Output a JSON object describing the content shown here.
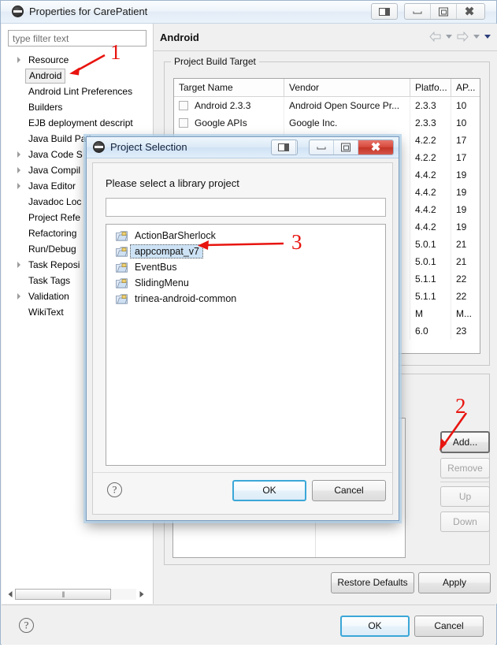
{
  "window": {
    "title": "Properties for CarePatient",
    "icon": "eclipse-icon",
    "titlebar_buttons": [
      {
        "name": "restore-pane-icon",
        "label": ""
      },
      {
        "name": "minimize-icon",
        "label": ""
      },
      {
        "name": "maximize-icon",
        "label": ""
      },
      {
        "name": "close-icon",
        "label": "✕"
      }
    ]
  },
  "sidebar": {
    "filter": {
      "placeholder": "type filter text",
      "value": ""
    },
    "items": [
      {
        "label": "Resource",
        "expandable": true,
        "selected": false
      },
      {
        "label": "Android",
        "expandable": false,
        "selected": true
      },
      {
        "label": "Android Lint Preferences",
        "expandable": false,
        "selected": false
      },
      {
        "label": "Builders",
        "expandable": false,
        "selected": false
      },
      {
        "label": "EJB deployment descript",
        "expandable": false,
        "selected": false
      },
      {
        "label": "Java Build Path",
        "expandable": false,
        "selected": false
      },
      {
        "label": "Java Code S",
        "expandable": true,
        "selected": false
      },
      {
        "label": "Java Compil",
        "expandable": true,
        "selected": false
      },
      {
        "label": "Java Editor",
        "expandable": true,
        "selected": false
      },
      {
        "label": "Javadoc Loc",
        "expandable": false,
        "selected": false
      },
      {
        "label": "Project Refe",
        "expandable": false,
        "selected": false
      },
      {
        "label": "Refactoring",
        "expandable": false,
        "selected": false
      },
      {
        "label": "Run/Debug",
        "expandable": false,
        "selected": false
      },
      {
        "label": "Task Reposi",
        "expandable": true,
        "selected": false
      },
      {
        "label": "Task Tags",
        "expandable": false,
        "selected": false
      },
      {
        "label": "Validation",
        "expandable": true,
        "selected": false
      },
      {
        "label": "WikiText",
        "expandable": false,
        "selected": false
      }
    ]
  },
  "page": {
    "title": "Android",
    "nav": {
      "back_icon": "arrow-left-icon",
      "back_caret": "chevron-down-icon",
      "forward_icon": "arrow-right-icon",
      "forward_caret": "chevron-down-icon",
      "menu_caret": "chevron-down-icon"
    },
    "build_target": {
      "legend": "Project Build Target",
      "columns": [
        "Target Name",
        "Vendor",
        "Platfo...",
        "AP..."
      ],
      "rows": [
        {
          "checked": false,
          "name": "Android 2.3.3",
          "vendor": "Android Open Source Pr...",
          "platform": "2.3.3",
          "api": "10"
        },
        {
          "checked": false,
          "name": "Google APIs",
          "vendor": "Google Inc.",
          "platform": "2.3.3",
          "api": "10"
        },
        {
          "checked": false,
          "name": "",
          "vendor": "",
          "platform": "4.2.2",
          "api": "17"
        },
        {
          "checked": false,
          "name": "",
          "vendor": "",
          "platform": "4.2.2",
          "api": "17"
        },
        {
          "checked": false,
          "name": "",
          "vendor": "",
          "platform": "4.4.2",
          "api": "19"
        },
        {
          "checked": false,
          "name": "",
          "vendor": "",
          "platform": "4.4.2",
          "api": "19"
        },
        {
          "checked": false,
          "name": "",
          "vendor": "",
          "platform": "4.4.2",
          "api": "19"
        },
        {
          "checked": false,
          "name": "",
          "vendor": "",
          "platform": "4.4.2",
          "api": "19"
        },
        {
          "checked": false,
          "name": "",
          "vendor": "",
          "platform": "5.0.1",
          "api": "21"
        },
        {
          "checked": false,
          "name": "",
          "vendor": "",
          "platform": "5.0.1",
          "api": "21"
        },
        {
          "checked": false,
          "name": "",
          "vendor": "",
          "platform": "5.1.1",
          "api": "22"
        },
        {
          "checked": false,
          "name": "",
          "vendor": "",
          "platform": "5.1.1",
          "api": "22"
        },
        {
          "checked": false,
          "name": "",
          "vendor": "",
          "platform": "M",
          "api": "M..."
        },
        {
          "checked": false,
          "name": "",
          "vendor": "",
          "platform": "6.0",
          "api": "23"
        }
      ]
    },
    "library_buttons": [
      {
        "label": "Add...",
        "enabled": true,
        "emphasized": true
      },
      {
        "label": "Remove",
        "enabled": false,
        "emphasized": false
      },
      {
        "label": "Up",
        "enabled": false,
        "emphasized": false
      },
      {
        "label": "Down",
        "enabled": false,
        "emphasized": false
      }
    ],
    "footer_buttons": [
      {
        "label": "Restore Defaults",
        "enabled": true
      },
      {
        "label": "Apply",
        "enabled": true
      }
    ]
  },
  "window_footer": {
    "help_icon": "help-icon",
    "buttons": [
      {
        "label": "OK",
        "primary": true
      },
      {
        "label": "Cancel",
        "primary": false
      }
    ]
  },
  "dialog": {
    "title": "Project Selection",
    "icon": "eclipse-icon",
    "titlebar_buttons": [
      {
        "name": "restore-pane-icon",
        "label": ""
      },
      {
        "name": "minimize-icon",
        "label": ""
      },
      {
        "name": "maximize-icon",
        "label": ""
      },
      {
        "name": "close-icon",
        "label": "✕"
      }
    ],
    "prompt": "Please select a library project",
    "filter": {
      "value": "",
      "placeholder": ""
    },
    "items": [
      {
        "label": "ActionBarSherlock",
        "selected": false,
        "icon": "project-folder-icon"
      },
      {
        "label": "appcompat_v7",
        "selected": true,
        "icon": "project-folder-icon"
      },
      {
        "label": "EventBus",
        "selected": false,
        "icon": "project-folder-icon"
      },
      {
        "label": "SlidingMenu",
        "selected": false,
        "icon": "project-folder-icon"
      },
      {
        "label": "trinea-android-common",
        "selected": false,
        "icon": "project-folder-icon"
      }
    ],
    "help_icon": "help-icon",
    "buttons": [
      {
        "label": "OK",
        "primary": true
      },
      {
        "label": "Cancel",
        "primary": false
      }
    ]
  },
  "annotations": {
    "color": "#e8140f",
    "markers": [
      {
        "number": "1",
        "target": "sidebar-item-android"
      },
      {
        "number": "2",
        "target": "add-library-button"
      },
      {
        "number": "3",
        "target": "dialog-item-appcompat_v7"
      }
    ]
  }
}
